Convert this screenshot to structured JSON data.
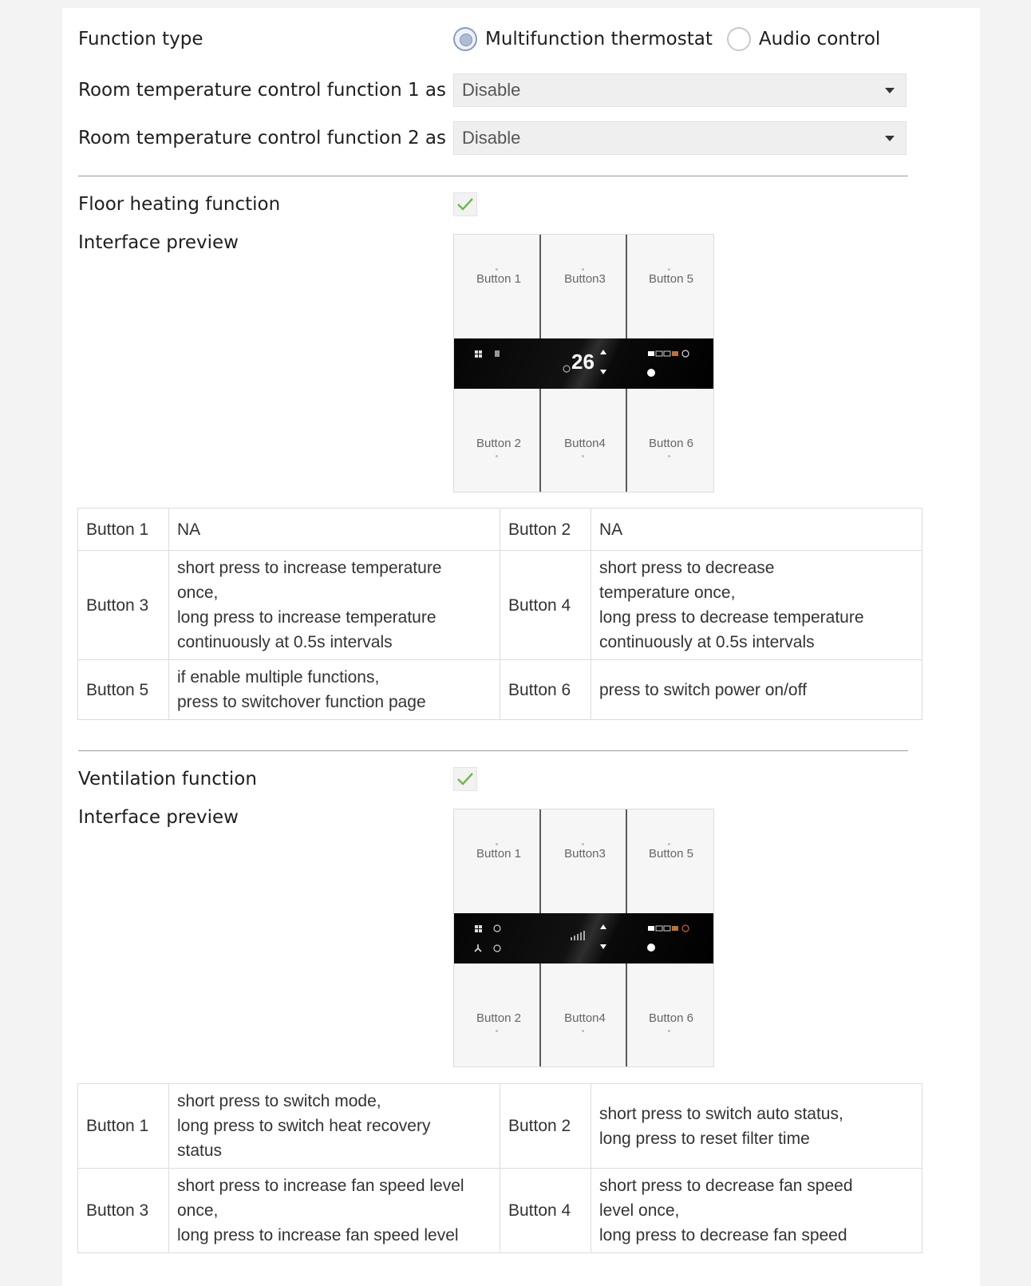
{
  "function_type": {
    "label": "Function type",
    "options": [
      "Multifunction thermostat",
      "Audio control"
    ],
    "selected": "Multifunction thermostat"
  },
  "rtc1": {
    "label": "Room temperature control function 1 as",
    "value": "Disable"
  },
  "rtc2": {
    "label": "Room temperature control function 2 as",
    "value": "Disable"
  },
  "floor": {
    "label": "Floor heating function",
    "checked": true,
    "preview_label": "Interface preview",
    "preview": {
      "buttons_top": [
        "Button 1",
        "Button3",
        "Button 5"
      ],
      "buttons_bottom": [
        "Button 2",
        "Button4",
        "Button 6"
      ],
      "display_temp": "26"
    },
    "table": [
      {
        "k1": "Button 1",
        "v1": [
          "NA"
        ],
        "k2": "Button 2",
        "v2": [
          "NA"
        ]
      },
      {
        "k1": "Button 3",
        "v1": [
          "short press to increase temperature",
          "once,",
          "long press to increase temperature",
          "continuously at 0.5s intervals"
        ],
        "k2": "Button 4",
        "v2": [
          "short press to decrease",
          "temperature once,",
          "long press to decrease temperature",
          "continuously at 0.5s intervals"
        ]
      },
      {
        "k1": "Button 5",
        "v1": [
          "if enable multiple functions,",
          "press to switchover function page"
        ],
        "k2": "Button 6",
        "v2": [
          "press to switch power on/off"
        ]
      }
    ]
  },
  "ventilation": {
    "label": "Ventilation function",
    "checked": true,
    "preview_label": "Interface preview",
    "preview": {
      "buttons_top": [
        "Button 1",
        "Button3",
        "Button 5"
      ],
      "buttons_bottom": [
        "Button 2",
        "Button4",
        "Button 6"
      ]
    },
    "table": [
      {
        "k1": "Button 1",
        "v1": [
          "short press to switch mode,",
          "long press to switch heat recovery",
          "status"
        ],
        "k2": "Button 2",
        "v2": [
          "short press to switch auto status,",
          "long press to reset filter time"
        ]
      },
      {
        "k1": "Button 3",
        "v1": [
          "short press to increase fan speed level",
          "once,",
          "long press to increase fan speed level"
        ],
        "k2": "Button 4",
        "v2": [
          "short press to decrease fan speed",
          "level once,",
          "long press to decrease fan speed"
        ]
      }
    ]
  }
}
